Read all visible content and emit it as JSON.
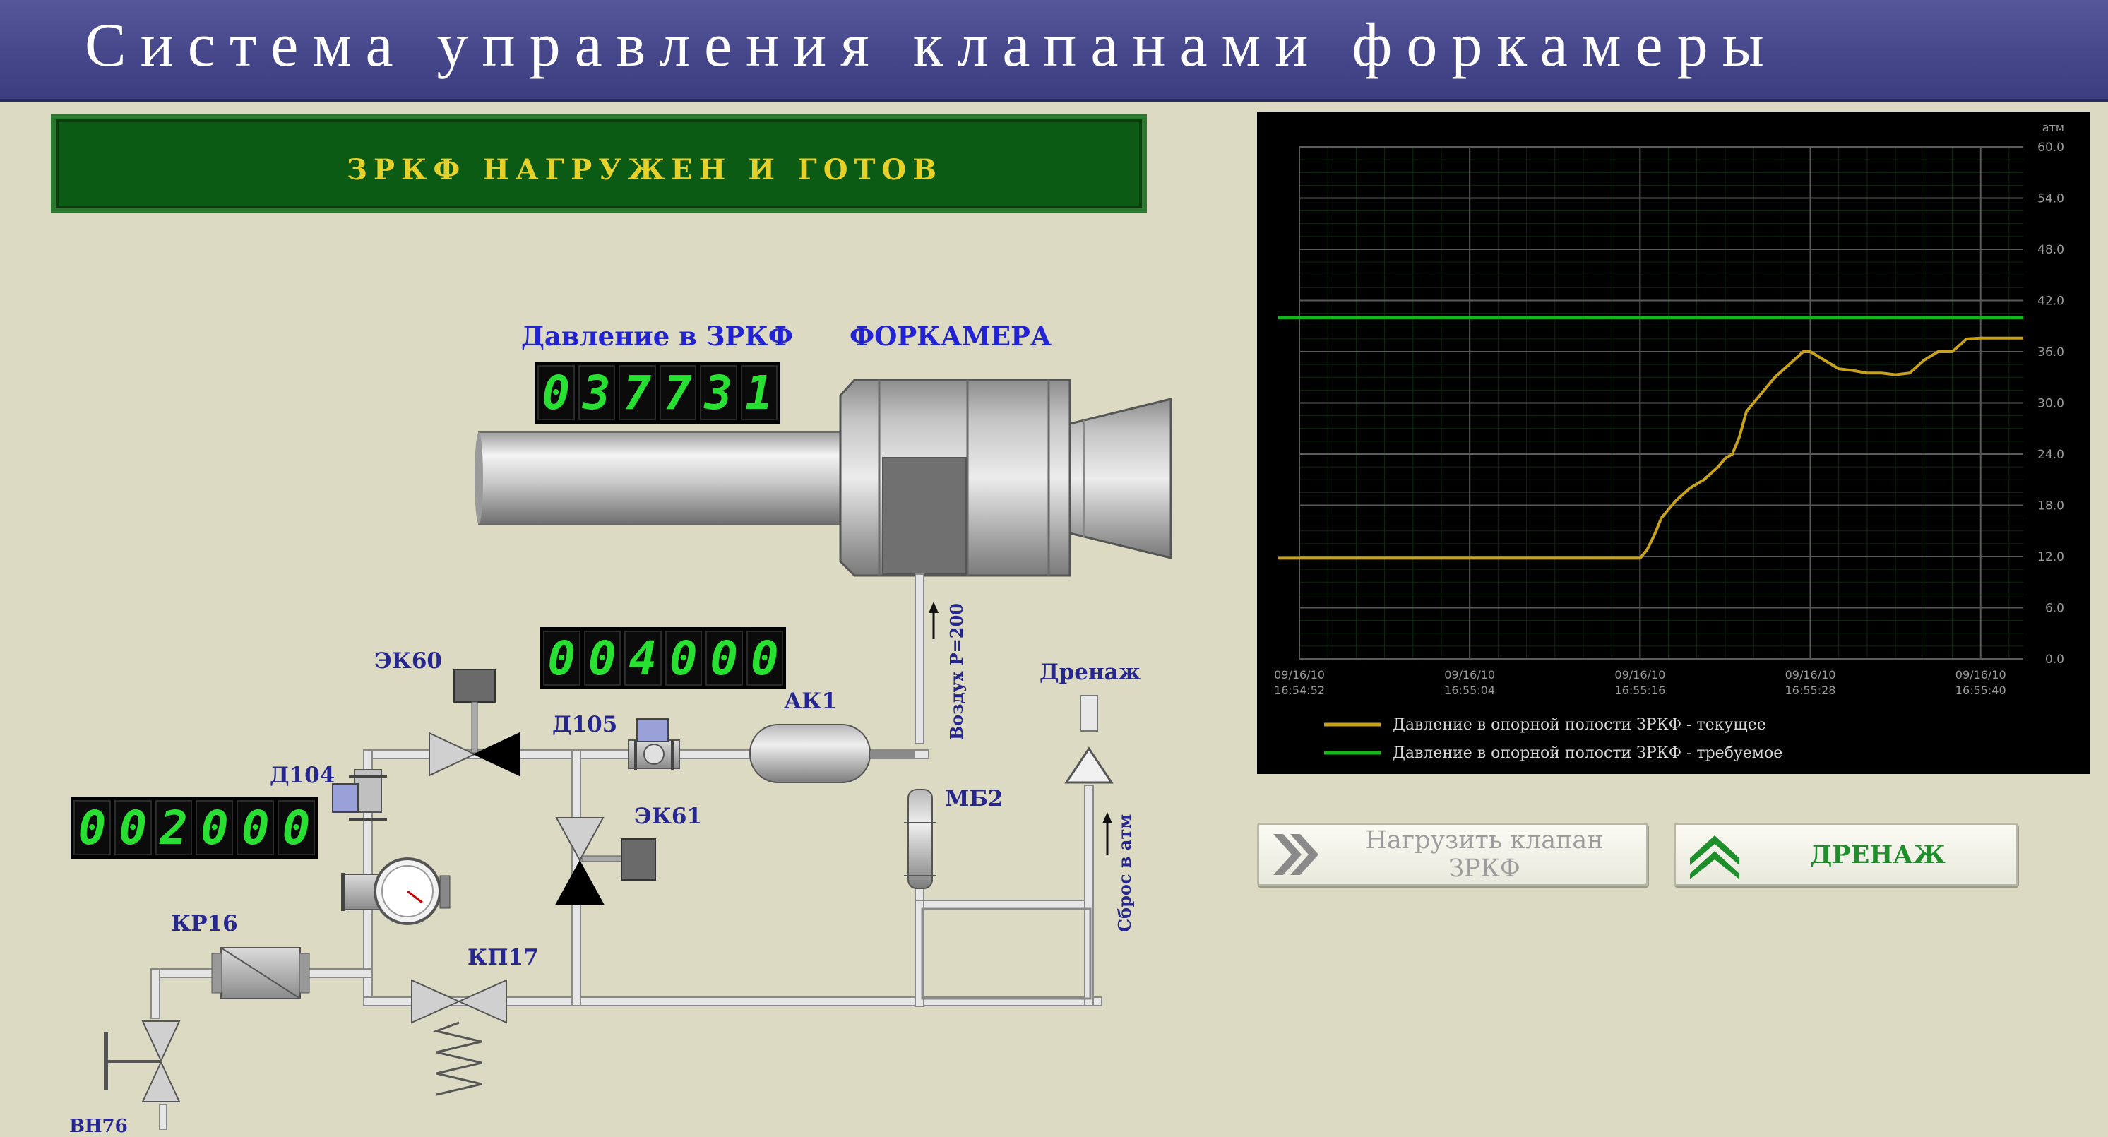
{
  "header": {
    "title": "Система управления клапанами форкамеры"
  },
  "status_banner": {
    "text": "ЗРКФ НАГРУЖЕН И ГОТОВ"
  },
  "labels": {
    "pressure_label": "Давление в ЗРКФ",
    "forkamera": "ФОРКАМЕРА",
    "drain": "Дренаж",
    "air_supply": "Воздух Р=200",
    "vent": "Сброс в атм"
  },
  "displays": {
    "pressure": [
      "0",
      "3",
      "7",
      "7",
      "3",
      "1"
    ],
    "mid": [
      "0",
      "0",
      "4",
      "0",
      "0",
      "0"
    ],
    "left": [
      "0",
      "0",
      "2",
      "0",
      "0",
      "0"
    ]
  },
  "components": {
    "ek60": "ЭК60",
    "d105": "Д105",
    "ak1": "АК1",
    "d104": "Д104",
    "ek61": "ЭК61",
    "mb2": "МБ2",
    "kr16": "КР16",
    "kp17": "КП17",
    "vn76": "ВН76"
  },
  "buttons": {
    "load_valve": "Нагрузить клапан ЗРКФ",
    "drain": "ДРЕНАЖ"
  },
  "colors": {
    "title_bar": "#45468a",
    "background": "#dcdac2",
    "status_bg": "#0b5b14",
    "status_text": "#e6d12a",
    "digit_green": "#27e032",
    "current_series": "#c8a21c",
    "target_series": "#13b61b",
    "load_icon": "#8a8a8a",
    "drain_icon": "#1f8f2b"
  },
  "icons": {
    "load_valve": "double-chevron-right-icon",
    "drain": "double-chevron-up-icon"
  },
  "chart_data": {
    "type": "line",
    "unit_label": "атм",
    "ylim": [
      0,
      60
    ],
    "yticks": [
      "0.0",
      "6.0",
      "12.0",
      "18.0",
      "24.0",
      "30.0",
      "36.0",
      "42.0",
      "48.0",
      "54.0",
      "60.0"
    ],
    "xlim": [
      0,
      102
    ],
    "xticks": [
      {
        "t": 0,
        "date": "09/16/10",
        "time": "16:54:52"
      },
      {
        "t": 24,
        "date": "09/16/10",
        "time": "16:55:04"
      },
      {
        "t": 48,
        "date": "09/16/10",
        "time": "16:55:16"
      },
      {
        "t": 72,
        "date": "09/16/10",
        "time": "16:55:28"
      },
      {
        "t": 96,
        "date": "09/16/10",
        "time": "16:55:40"
      }
    ],
    "grid": true,
    "legend_position": "bottom",
    "series": [
      {
        "name": "Давление в опорной полости ЗРКФ - текущее",
        "color": "#c8a21c",
        "points": [
          [
            -10,
            11.8
          ],
          [
            48,
            11.8
          ],
          [
            49,
            12.8
          ],
          [
            50,
            14.5
          ],
          [
            51,
            16.5
          ],
          [
            52,
            17.5
          ],
          [
            53,
            18.5
          ],
          [
            55,
            20.0
          ],
          [
            57,
            21.0
          ],
          [
            59,
            22.5
          ],
          [
            60,
            23.5
          ],
          [
            61,
            24.0
          ],
          [
            62,
            26.0
          ],
          [
            63,
            29.0
          ],
          [
            65,
            31.0
          ],
          [
            67,
            33.0
          ],
          [
            69,
            34.5
          ],
          [
            71,
            36.0
          ],
          [
            72,
            36.0
          ],
          [
            74,
            35.0
          ],
          [
            76,
            34.0
          ],
          [
            78,
            33.8
          ],
          [
            80,
            33.5
          ],
          [
            82,
            33.5
          ],
          [
            84,
            33.3
          ],
          [
            86,
            33.5
          ],
          [
            88,
            35.0
          ],
          [
            90,
            36.0
          ],
          [
            92,
            36.0
          ],
          [
            94,
            37.5
          ],
          [
            96,
            37.6
          ],
          [
            102,
            37.6
          ]
        ]
      },
      {
        "name": "Давление в опорной полости ЗРКФ - требуемое",
        "color": "#13b61b",
        "points": [
          [
            -10,
            40.0
          ],
          [
            102,
            40.0
          ]
        ]
      }
    ]
  }
}
